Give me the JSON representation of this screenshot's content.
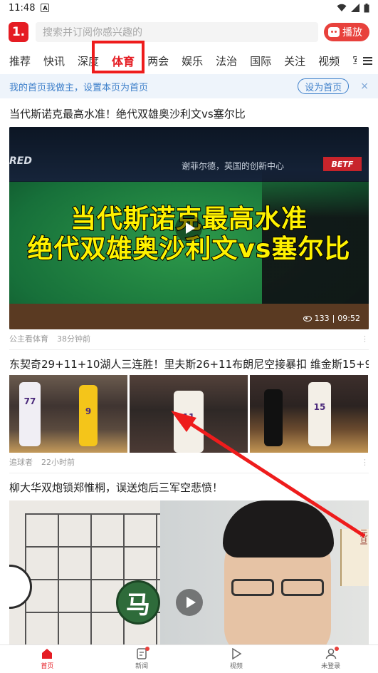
{
  "status_bar": {
    "time": "11:48",
    "notif_badge": "A"
  },
  "header": {
    "logo_text": "1.",
    "search_placeholder": "搜索并订阅你感兴趣的",
    "play_label": "播放"
  },
  "tabs": [
    {
      "label": "推荐",
      "active": false
    },
    {
      "label": "快讯",
      "active": false
    },
    {
      "label": "深度",
      "active": false
    },
    {
      "label": "体育",
      "active": true
    },
    {
      "label": "两会",
      "active": false
    },
    {
      "label": "娱乐",
      "active": false
    },
    {
      "label": "法治",
      "active": false
    },
    {
      "label": "国际",
      "active": false
    },
    {
      "label": "关注",
      "active": false
    },
    {
      "label": "视频",
      "active": false
    },
    {
      "label": "军",
      "active": false
    }
  ],
  "banner": {
    "text": "我的首页我做主，设置本页为首页",
    "button": "设为首页",
    "close": "×"
  },
  "articles": [
    {
      "title": "当代斯诺克最高水准！绝代双雄奥沙利文vs塞尔比",
      "overlay_line1": "当代斯诺克最高水准",
      "overlay_line2": "绝代双雄奥沙利文vs塞尔比",
      "ad_left": "RED",
      "ad_mid": "谢菲尔德，英国的创新中心",
      "ad_right": "BETF",
      "views": "133",
      "duration": "09:52",
      "source": "公主看体育",
      "time": "38分钟前"
    },
    {
      "title": "东契奇29+11+10湖人三连胜！里夫斯26+11布朗尼空接暴扣 维金斯15+9",
      "jerseys": [
        "77",
        "9",
        "11",
        "15"
      ],
      "source": "追球者",
      "time": "22小时前"
    },
    {
      "title": "柳大华双炮锁郑惟桐，误送炮后三军空悲愤！",
      "piece_text": "马",
      "sign_text": "元旦"
    }
  ],
  "bottom_nav": [
    {
      "label": "首页",
      "icon": "home-icon",
      "active": true
    },
    {
      "label": "新闻",
      "icon": "news-icon",
      "active": false,
      "dot": true
    },
    {
      "label": "视频",
      "icon": "video-icon",
      "active": false
    },
    {
      "label": "未登录",
      "icon": "user-icon",
      "active": false,
      "dot": true
    }
  ],
  "colors": {
    "brand": "#e51c23",
    "highlight": "#ee1c1c",
    "link": "#3d7fca"
  }
}
